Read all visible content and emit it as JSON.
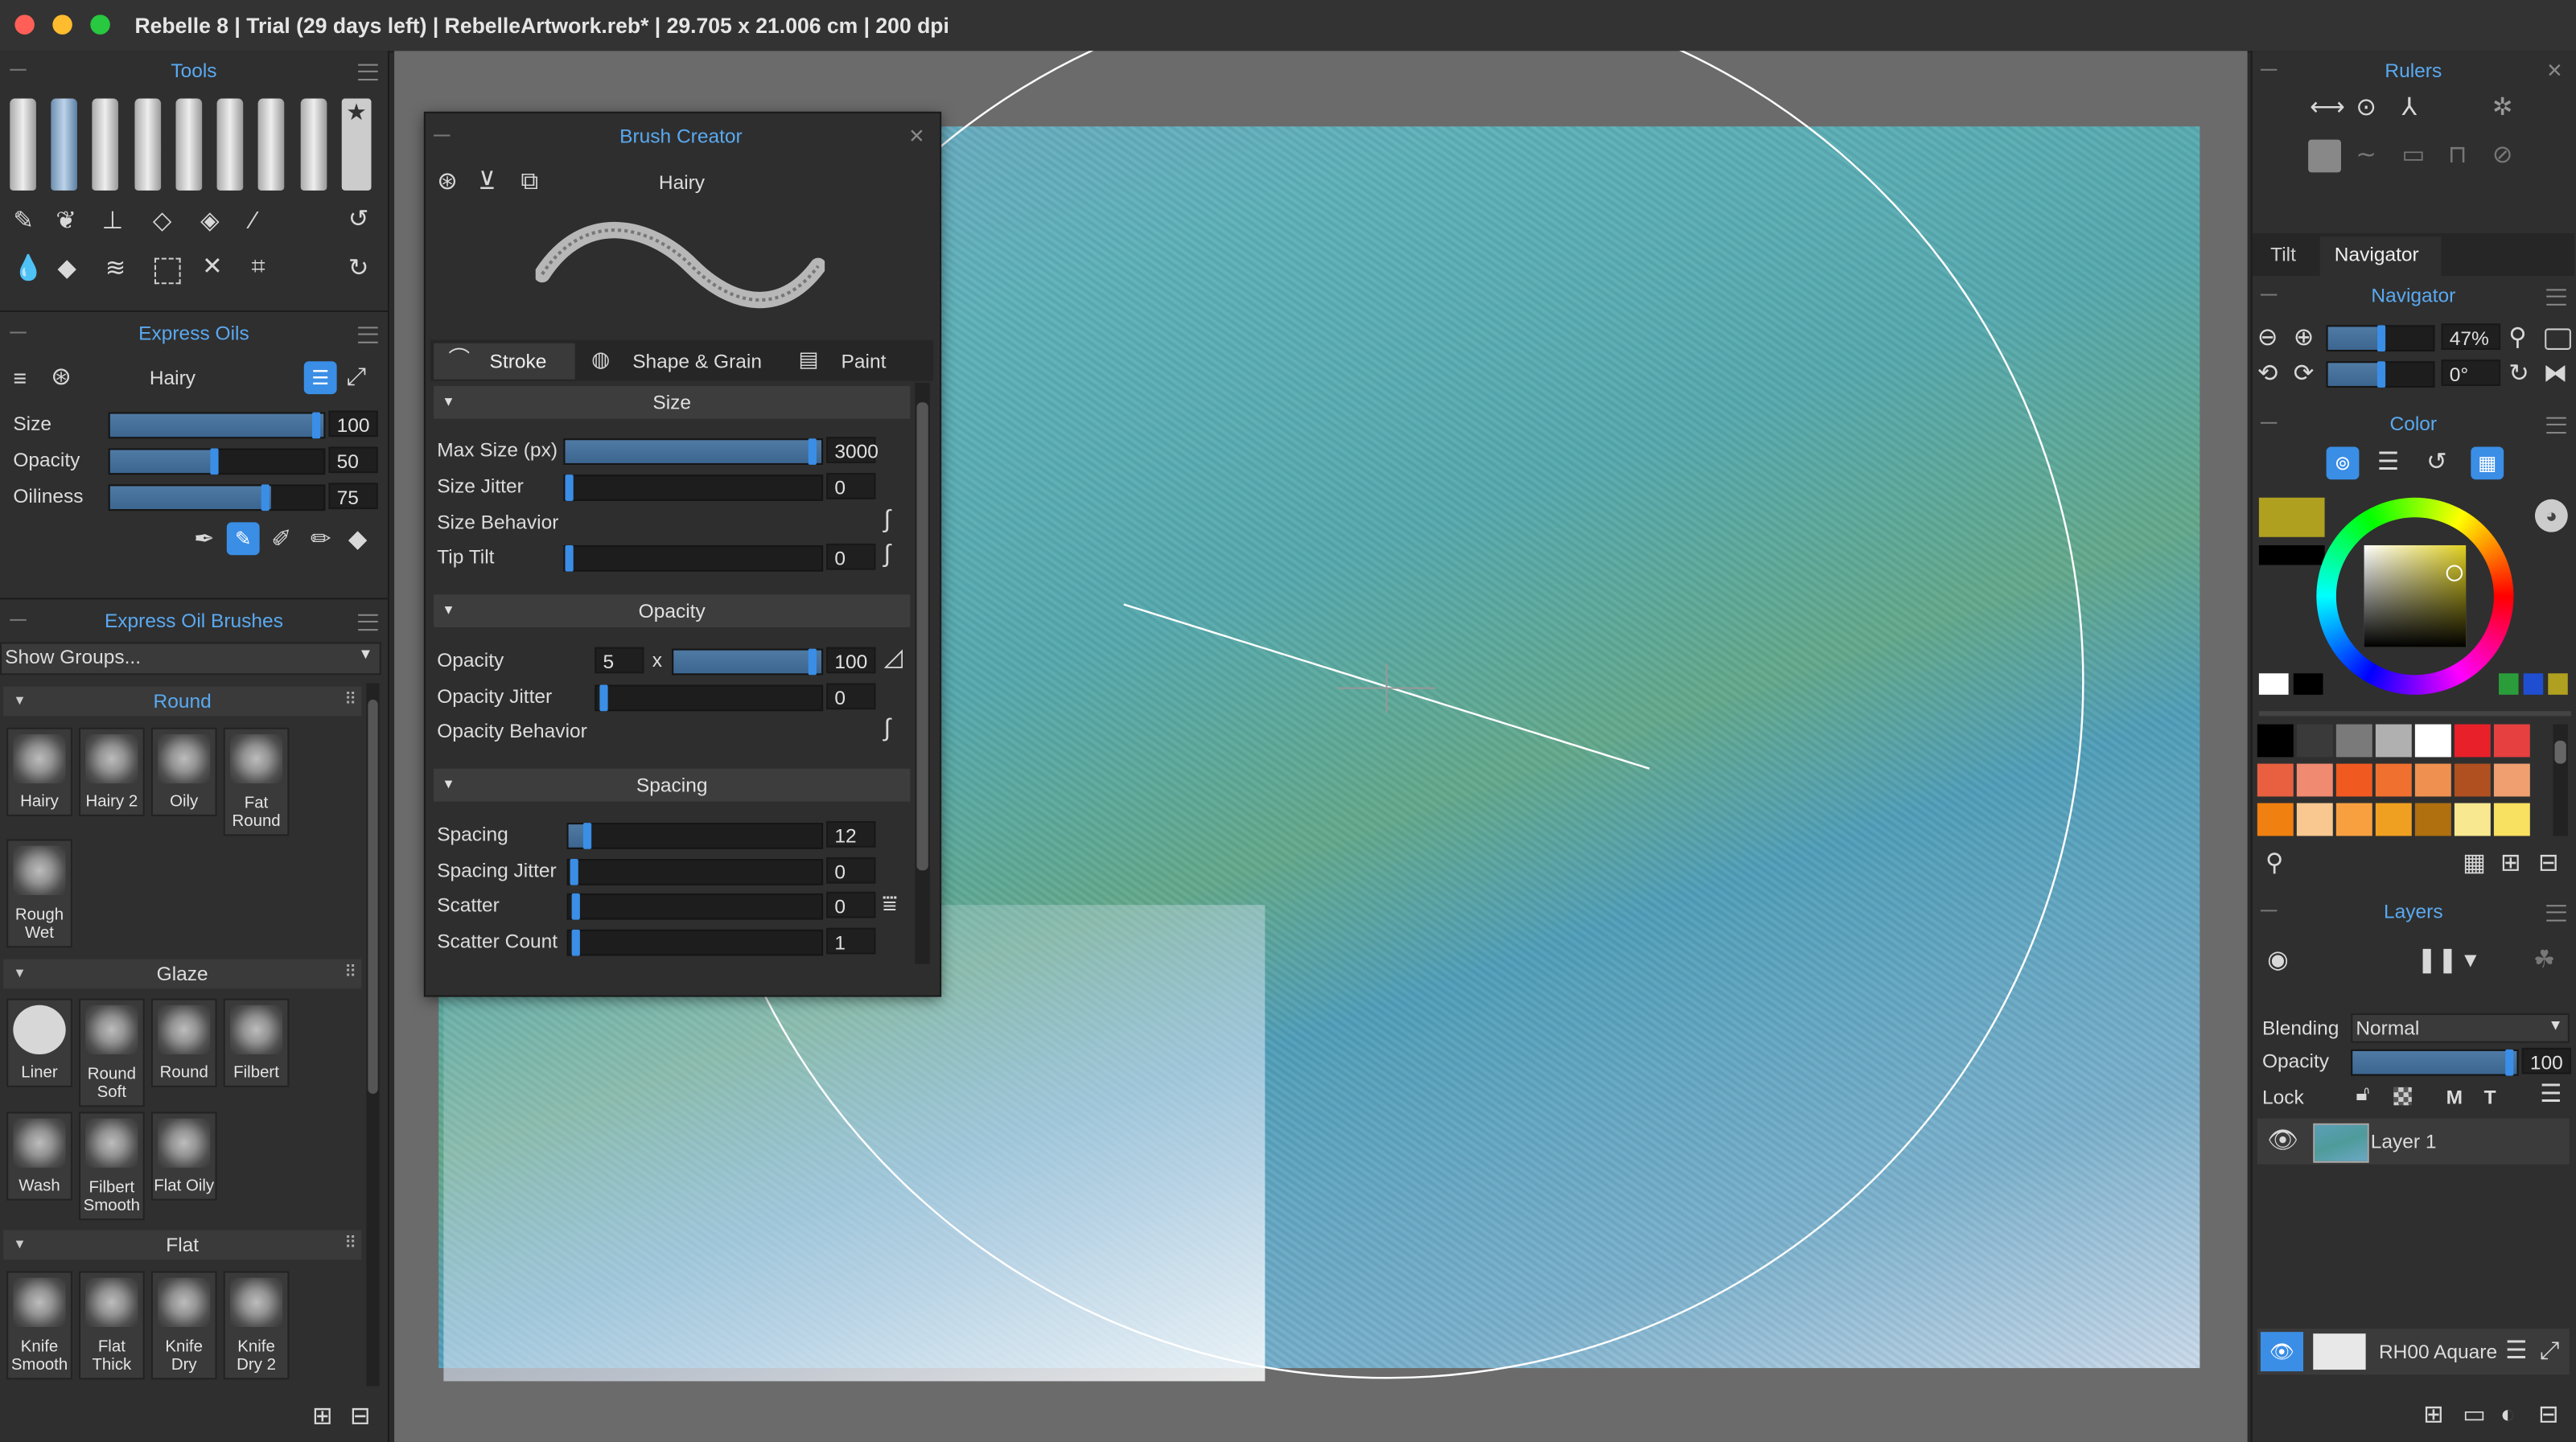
{
  "window": {
    "title": "Rebelle 8 | Trial (29 days left) | RebelleArtwork.reb* | 29.705 x 21.006 cm | 200 dpi"
  },
  "tools_panel": {
    "title": "Tools"
  },
  "express_oils": {
    "title": "Express Oils",
    "brush_name": "Hairy",
    "sliders": [
      {
        "label": "Size",
        "value": "100",
        "fraction": 1.0
      },
      {
        "label": "Opacity",
        "value": "50",
        "fraction": 0.5
      },
      {
        "label": "Oiliness",
        "value": "75",
        "fraction": 0.75
      }
    ]
  },
  "brushes_panel": {
    "title": "Express Oil Brushes",
    "groups_select": "Show Groups...",
    "groups": [
      {
        "name": "Round",
        "brushes": [
          "Hairy",
          "Hairy 2",
          "Oily",
          "Fat Round",
          "Rough Wet"
        ]
      },
      {
        "name": "Glaze",
        "brushes": [
          "Liner",
          "Round Soft",
          "Round",
          "Filbert",
          "Wash",
          "Filbert Smooth",
          "Flat Oily"
        ]
      },
      {
        "name": "Flat",
        "brushes": [
          "Knife Smooth",
          "Flat Thick",
          "Knife Dry",
          "Knife Dry 2"
        ]
      }
    ]
  },
  "brush_creator": {
    "title": "Brush Creator",
    "brush_name": "Hairy",
    "tabs": [
      "Stroke",
      "Shape & Grain",
      "Paint"
    ],
    "sections": {
      "size": "Size",
      "opacity": "Opacity",
      "spacing": "Spacing"
    },
    "size_rows": [
      {
        "label": "Max Size (px)",
        "value": "3000",
        "fraction": 1.0
      },
      {
        "label": "Size Jitter",
        "value": "0",
        "fraction": 0.0
      },
      {
        "label": "Size Behavior"
      },
      {
        "label": "Tip Tilt",
        "value": "0",
        "fraction": 0.0
      }
    ],
    "opacity_rows": {
      "opacity_label": "Opacity",
      "opacity_min": "5",
      "times": "x",
      "opacity_value": "100",
      "opacity_fraction": 1.0,
      "jitter_label": "Opacity Jitter",
      "jitter_value": "0",
      "behavior_label": "Opacity Behavior"
    },
    "spacing_rows": [
      {
        "label": "Spacing",
        "value": "12",
        "fraction": 0.06
      },
      {
        "label": "Spacing Jitter",
        "value": "0",
        "fraction": 0.0
      },
      {
        "label": "Scatter",
        "value": "0",
        "fraction": 0.0
      },
      {
        "label": "Scatter Count",
        "value": "1",
        "fraction": 0.0
      }
    ]
  },
  "rulers": {
    "title": "Rulers"
  },
  "nav_tabs": [
    "Tilt",
    "Navigator"
  ],
  "navigator": {
    "title": "Navigator",
    "zoom": "47%",
    "rotation": "0°"
  },
  "color": {
    "title": "Color",
    "current": "#b0a020",
    "palette": [
      [
        "#000000",
        "#3a3a3a",
        "#7a7a7a",
        "#b0b0b0",
        "#ffffff",
        "#e8202a",
        "#e64040"
      ],
      [
        "#e86040",
        "#f08a70",
        "#f05a20",
        "#f07030",
        "#f09050",
        "#b05020",
        "#f0a070"
      ],
      [
        "#f08010",
        "#f8c890",
        "#f8a040",
        "#f0a020",
        "#b07010",
        "#f8e890",
        "#f8e060"
      ]
    ]
  },
  "layers": {
    "title": "Layers",
    "blending_label": "Blending",
    "blending_value": "Normal",
    "opacity_label": "Opacity",
    "opacity_value": "100",
    "opacity_fraction": 1.0,
    "lock_label": "Lock",
    "lock_m": "M",
    "lock_t": "T",
    "items": [
      {
        "name": "Layer 1"
      }
    ],
    "paper": "RH00 Aquare"
  }
}
